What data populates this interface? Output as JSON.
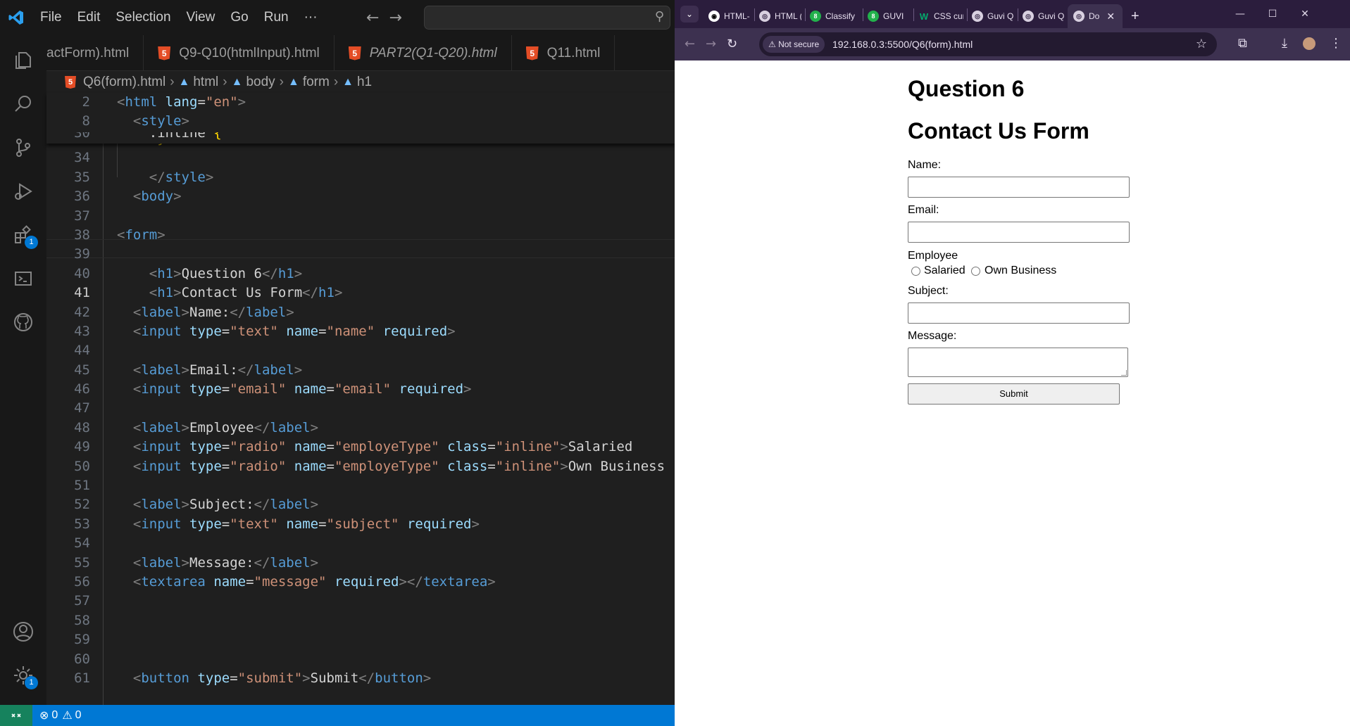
{
  "vscode": {
    "menu": [
      "File",
      "Edit",
      "Selection",
      "View",
      "Go",
      "Run",
      "···"
    ],
    "tabs": [
      {
        "label": "actForm).html",
        "italic": false
      },
      {
        "label": "Q9-Q10(htmlInput).html",
        "italic": false
      },
      {
        "label": "PART2(Q1-Q20).html",
        "italic": true
      },
      {
        "label": "Q11.html",
        "italic": false
      }
    ],
    "breadcrumb": [
      "Q6(form).html",
      "html",
      "body",
      "form",
      "h1"
    ],
    "badges": {
      "extensions": "1",
      "settings": "1"
    },
    "status": {
      "errors": "0",
      "warnings": "0"
    }
  },
  "browser": {
    "tabs": [
      {
        "label": "HTML-",
        "icon": "github-icon"
      },
      {
        "label": "HTML (",
        "icon": "globe-icon"
      },
      {
        "label": "Classify",
        "icon": "guvi-icon"
      },
      {
        "label": "GUVI",
        "icon": "guvi-icon"
      },
      {
        "label": "CSS cur",
        "icon": "w3schools-icon"
      },
      {
        "label": "Guvi Q",
        "icon": "globe-icon"
      },
      {
        "label": "Guvi Q",
        "icon": "globe-icon"
      },
      {
        "label": "Do",
        "icon": "globe-icon",
        "active": true
      }
    ],
    "security_chip": "Not secure",
    "url": "192.168.0.3:5500/Q6(form).html"
  },
  "page": {
    "heading1": "Question 6",
    "heading2": "Contact Us Form",
    "name_label": "Name:",
    "email_label": "Email:",
    "employee_label": "Employee",
    "radio_salaried": "Salaried",
    "radio_own_business": "Own Business",
    "subject_label": "Subject:",
    "message_label": "Message:",
    "submit_label": "Submit"
  },
  "colors": {
    "vscode_bg": "#1f1f1f",
    "statusbar": "#0078d4",
    "chrome_frame": "#2b1d3d",
    "tag": "#569cd6",
    "attr": "#9cdcfe",
    "string": "#ce9178"
  }
}
